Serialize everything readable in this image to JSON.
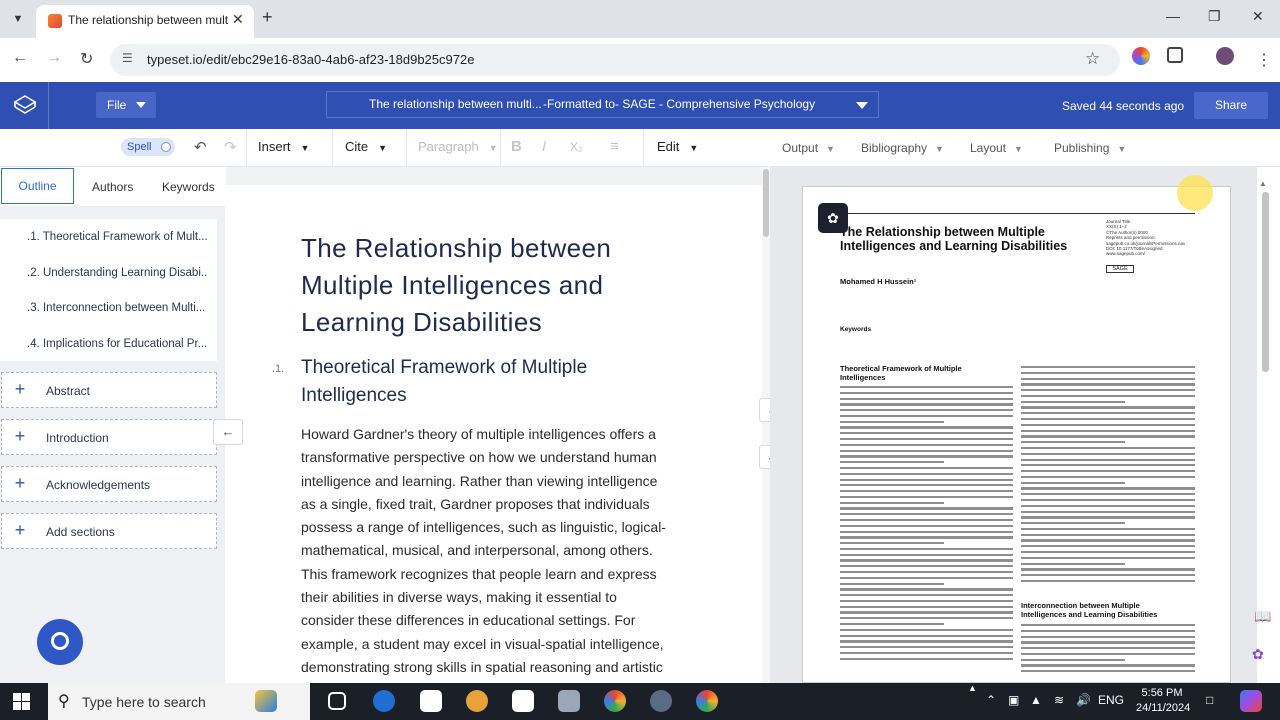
{
  "browser": {
    "tab_title": "The relationship between multi",
    "url": "typeset.io/edit/ebc29e16-83a0-4ab6-af23-18d9b25c972e"
  },
  "header": {
    "file_label": "File",
    "doc_title_short": "The relationship between multi...",
    "format_label": "-Formatted to-   SAGE - Comprehensive Psychology",
    "saved_status": "Saved 44 seconds ago",
    "share_label": "Share"
  },
  "toolbar": {
    "spell_label": "Spell",
    "insert_label": "Insert",
    "cite_label": "Cite",
    "paragraph_label": "Paragraph",
    "edit_label": "Edit"
  },
  "output_toolbar": {
    "output_label": "Output",
    "bibliography_label": "Bibliography",
    "layout_label": "Layout",
    "publishing_label": "Publishing"
  },
  "left_panel": {
    "tabs": [
      "Outline",
      "Authors",
      "Keywords"
    ],
    "outline_items": [
      ".1. Theoretical Framework of Mult...",
      ".2. Understanding Learning Disabi...",
      ".3. Interconnection between Multi...",
      ".4. Implications for Educational Pr..."
    ],
    "sections": [
      "Abstract",
      "Introduction",
      "Acknowledgements",
      "Add sections"
    ]
  },
  "editor": {
    "title": "The Relationship between Multiple Intelligences and Learning Disabilities",
    "section_number": ".1.",
    "section_title": "Theoretical Framework of Multiple Intelligences",
    "paragraph_lines": [
      "Howard Gardner's theory of multiple intelligences offers a",
      "transformative perspective on how we understand human",
      "intelligence and learning. Rather than viewing intelligence",
      "as a single, fixed trait, Gardner proposes that individuals",
      "possess a range of intelligences, such as linguistic, logical-",
      "mathematical, musical, and interpersonal, among others.",
      "This framework recognizes that people learn and express",
      "their abilities in diverse ways, making it essential to",
      "consider these differences in educational settings. For",
      "example, a student may excel in visual-spatial intelligence,",
      "demonstrating strong skills in spatial reasoning and artistic"
    ]
  },
  "preview": {
    "title": "The Relationship between Multiple Intelligences and Learning Disabilities",
    "meta_lines": [
      "Journal Title",
      "XX(X):1–2",
      "©The Author(s) 0000",
      "Reprints and permission:",
      "sagepub.co.uk/journalsPermissions.nav",
      "DOI: 10.1177/ToBeAssigned",
      "www.sagepub.com/"
    ],
    "sage_label": "SAGE",
    "author": "Mohamed H Hussein¹",
    "keywords_label": "Keywords",
    "h1": "Theoretical Framework of Multiple Intelligences",
    "h2": "Interconnection between Multiple Intelligences and Learning Disabilities"
  },
  "taskbar": {
    "search_placeholder": "Type here to search",
    "language": "ENG",
    "time": "5:56 PM",
    "date": "24/11/2024"
  },
  "colors": {
    "app_header": "#2f4fb3",
    "accent": "#2f6fd6"
  }
}
